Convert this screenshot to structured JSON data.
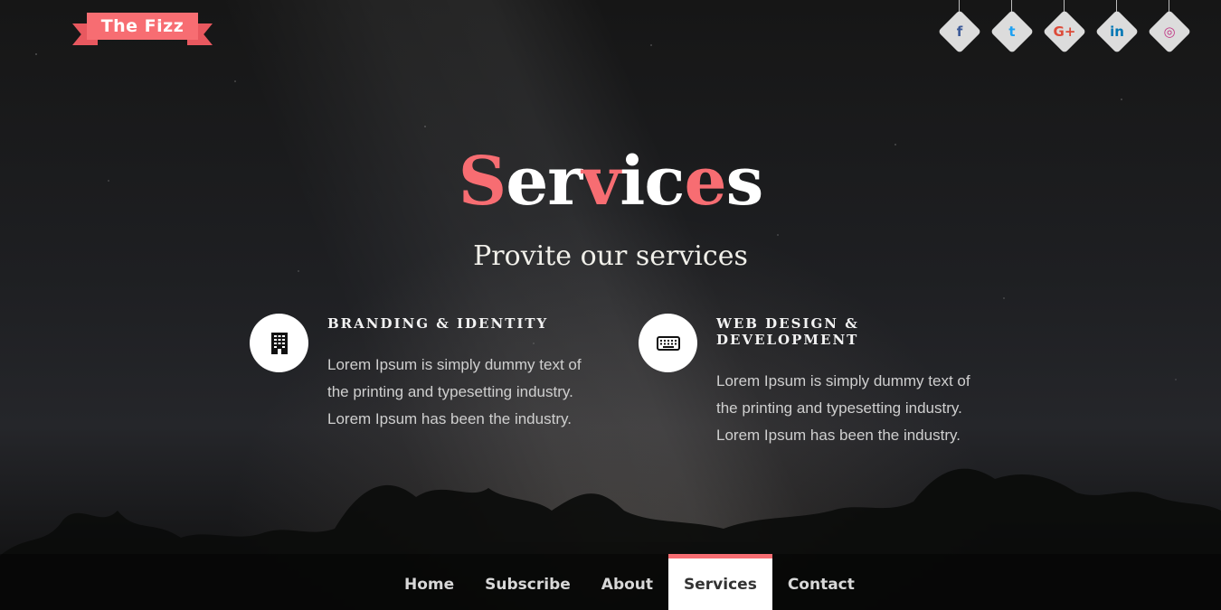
{
  "brand": {
    "name": "The Fizz"
  },
  "colors": {
    "accent": "#f76d72",
    "accent_dark": "#e8585f",
    "white": "#ffffff"
  },
  "social": [
    {
      "name": "facebook",
      "glyph": "f",
      "color": "#3b5998"
    },
    {
      "name": "twitter",
      "glyph": "t",
      "color": "#1da1f2"
    },
    {
      "name": "google-plus",
      "glyph": "G+",
      "color": "#dd4b39"
    },
    {
      "name": "linkedin",
      "glyph": "in",
      "color": "#0077b5"
    },
    {
      "name": "instagram",
      "glyph": "◎",
      "color": "#c13584"
    }
  ],
  "hero": {
    "title_letters": [
      {
        "ch": "S",
        "accent": true
      },
      {
        "ch": "e",
        "accent": false
      },
      {
        "ch": "r",
        "accent": false
      },
      {
        "ch": "v",
        "accent": true
      },
      {
        "ch": "i",
        "accent": false
      },
      {
        "ch": "c",
        "accent": false
      },
      {
        "ch": "e",
        "accent": true
      },
      {
        "ch": "s",
        "accent": false
      }
    ],
    "subtitle": "Provite our services"
  },
  "services": [
    {
      "icon": "building-icon",
      "title": "BRANDING & IDENTITY",
      "lines": [
        "Lorem Ipsum is simply dummy text of",
        "the printing and typesetting industry.",
        "Lorem Ipsum has been the industry."
      ]
    },
    {
      "icon": "keyboard-icon",
      "title": "WEB DESIGN & DEVELOPMENT",
      "lines": [
        "Lorem Ipsum is simply dummy text of",
        "the printing and typesetting industry.",
        "Lorem Ipsum has been the industry."
      ]
    }
  ],
  "nav": {
    "items": [
      "Home",
      "Subscribe",
      "About",
      "Services",
      "Contact"
    ],
    "active": "Services"
  }
}
